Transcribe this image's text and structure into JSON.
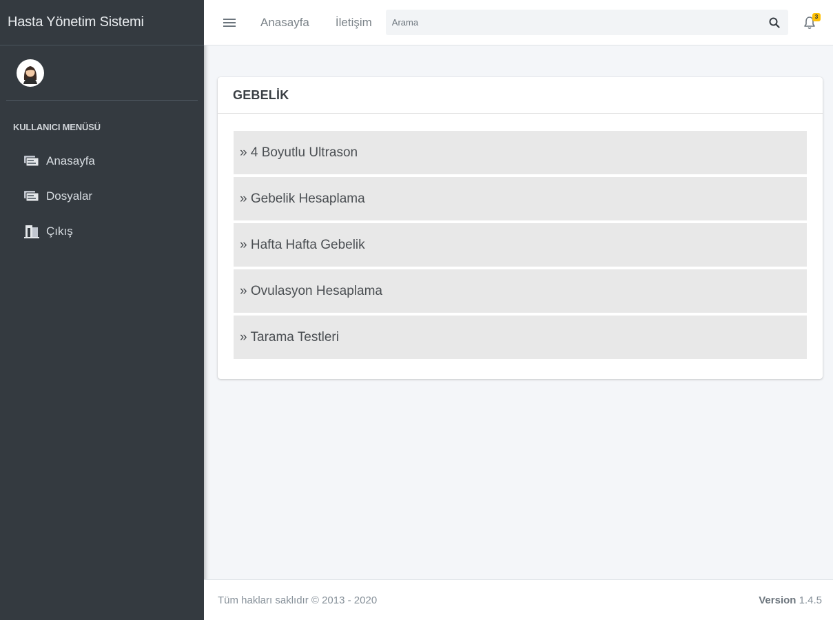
{
  "brand": {
    "title": "Hasta Yönetim Sistemi"
  },
  "sidebar": {
    "header": "KULLANICI MENÜSÜ",
    "items": [
      {
        "label": "Anasayfa",
        "icon": "folders-icon"
      },
      {
        "label": "Dosyalar",
        "icon": "folders-icon"
      },
      {
        "label": "Çıkış",
        "icon": "door-exit-icon"
      }
    ]
  },
  "topbar": {
    "links": [
      "Anasayfa",
      "İletişim"
    ],
    "search": {
      "placeholder": "Arama",
      "value": ""
    },
    "notifications": {
      "count": "3"
    }
  },
  "card": {
    "title": "GEBELİK",
    "items": [
      "» 4 Boyutlu Ultrason",
      "» Gebelik Hesaplama",
      "» Hafta Hafta Gebelik",
      "» Ovulasyon Hesaplama",
      "» Tarama Testleri"
    ]
  },
  "footer": {
    "copyright": "Tüm hakları saklıdır © 2013 - 2020",
    "version_label": "Version",
    "version_number": "1.4.5"
  },
  "colors": {
    "sidebar_bg": "#343a40",
    "content_bg": "#f4f6f9",
    "list_item_bg": "#e8e8e8",
    "badge": "#ffc107"
  }
}
